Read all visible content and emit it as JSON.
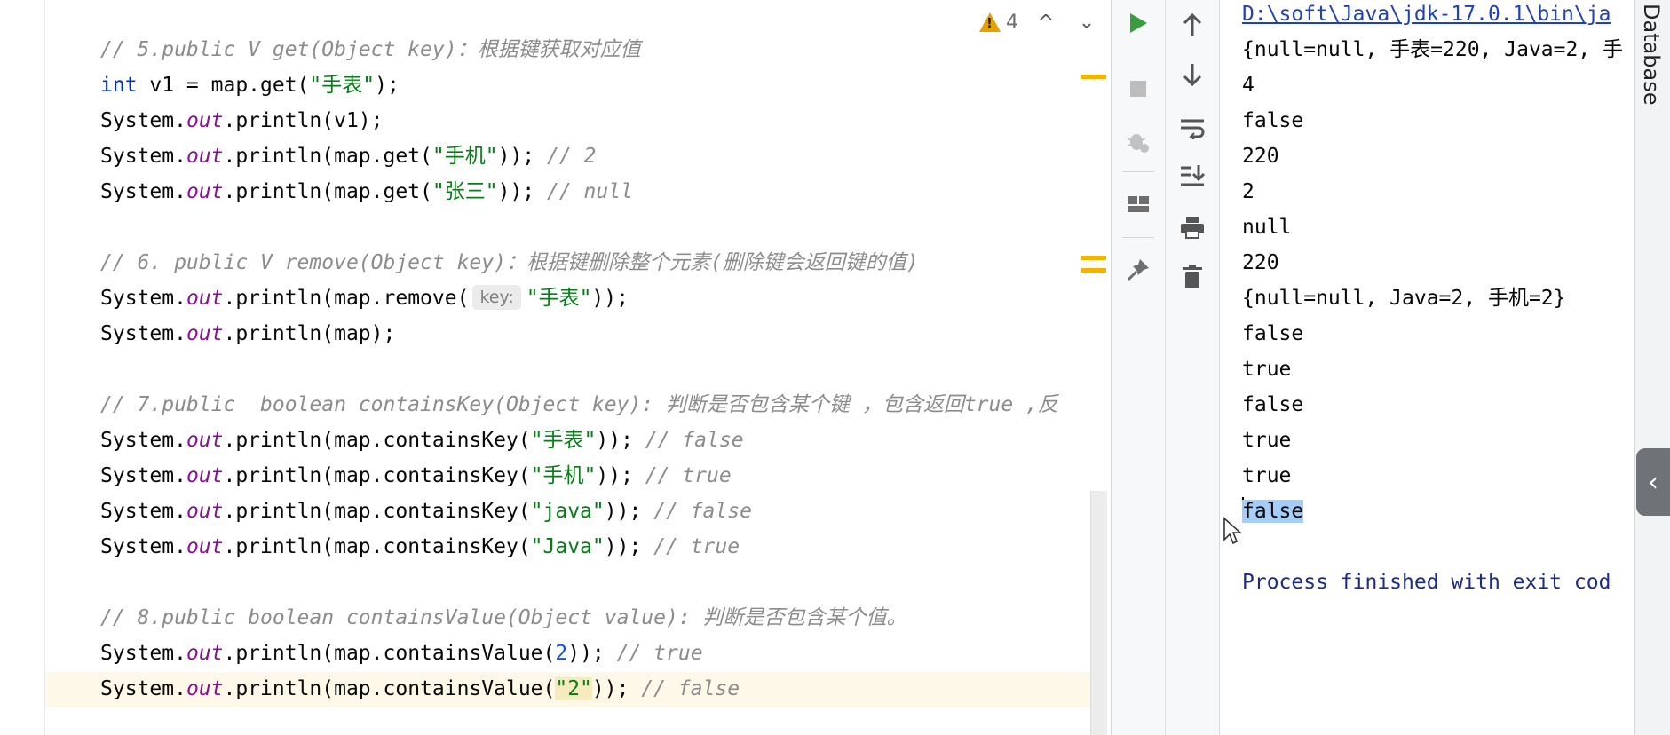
{
  "inspection": {
    "warning_count": "4",
    "up_label": "^",
    "down_label": "⌄"
  },
  "code": {
    "l1": {
      "comment": "// 5.public V get(Object key)：根据键获取对应值"
    },
    "l2": {
      "kw": "int",
      "a": " v1 = map.get(",
      "s": "\"手表\"",
      "b": ");"
    },
    "l3": {
      "a": "System.",
      "fd": "out",
      "b": ".println(v1);"
    },
    "l4": {
      "a": "System.",
      "fd": "out",
      "b": ".println(map.get(",
      "s": "\"手机\"",
      "c": ")); ",
      "cm": "// 2"
    },
    "l5": {
      "a": "System.",
      "fd": "out",
      "b": ".println(map.get(",
      "s": "\"张三\"",
      "c": ")); ",
      "cm": "// null"
    },
    "l6": {
      "comment": "// 6. public V remove(Object key)：根据键删除整个元素(删除键会返回键的值)"
    },
    "l7": {
      "a": "System.",
      "fd": "out",
      "b": ".println(map.remove(",
      "hint": "key:",
      "s": "\"手表\"",
      "c": "));"
    },
    "l8": {
      "a": "System.",
      "fd": "out",
      "b": ".println(map);"
    },
    "l9": {
      "comment": "// 7.public  boolean containsKey(Object key): 判断是否包含某个键 ，包含返回true ,反"
    },
    "l10": {
      "a": "System.",
      "fd": "out",
      "b": ".println(map.containsKey(",
      "s": "\"手表\"",
      "c": ")); ",
      "cm": "// false"
    },
    "l11": {
      "a": "System.",
      "fd": "out",
      "b": ".println(map.containsKey(",
      "s": "\"手机\"",
      "c": ")); ",
      "cm": "// true"
    },
    "l12": {
      "a": "System.",
      "fd": "out",
      "b": ".println(map.containsKey(",
      "s": "\"java\"",
      "c": ")); ",
      "cm": "// false"
    },
    "l13": {
      "a": "System.",
      "fd": "out",
      "b": ".println(map.containsKey(",
      "s": "\"Java\"",
      "c": ")); ",
      "cm": "// true"
    },
    "l14": {
      "comment": "// 8.public boolean containsValue(Object value): 判断是否包含某个值。"
    },
    "l15": {
      "a": "System.",
      "fd": "out",
      "b": ".println(map.containsValue(",
      "n": "2",
      "c": ")); ",
      "cm": "// true"
    },
    "l16": {
      "a": "System.",
      "fd": "out",
      "b": ".println(map.containsValue(",
      "s": "\"2\"",
      "c": ")); ",
      "cm": "// false"
    }
  },
  "toolbar": {
    "run_icon": "play-icon",
    "stop_icon": "stop-icon",
    "debug_icon": "bug-icon",
    "layout_icon": "layout-icon",
    "pin_icon": "pin-icon",
    "up_icon": "arrow-up-icon",
    "down_icon": "arrow-down-icon",
    "wrap_icon": "soft-wrap-icon",
    "scroll_icon": "scroll-to-end-icon",
    "print_icon": "print-icon",
    "trash_icon": "trash-icon"
  },
  "console": {
    "path": "D:\\soft\\Java\\jdk-17.0.1\\bin\\ja",
    "out1": "{null=null, 手表=220, Java=2, 手",
    "out2": "4",
    "out3": "false",
    "out4": "220",
    "out5": "2",
    "out6": "null",
    "out7": "220",
    "out8": "{null=null, Java=2, 手机=2}",
    "out9": "false",
    "out10": "true",
    "out11": "false",
    "out12": "true",
    "out13": "true",
    "out14": "false",
    "finished": "Process finished with exit cod"
  },
  "right_panel": {
    "database_label": "Database",
    "collapse_label": "‹"
  },
  "colors": {
    "accent_run": "#3a9b3f",
    "warning": "#e5a100",
    "selection": "#a6cdf5"
  }
}
